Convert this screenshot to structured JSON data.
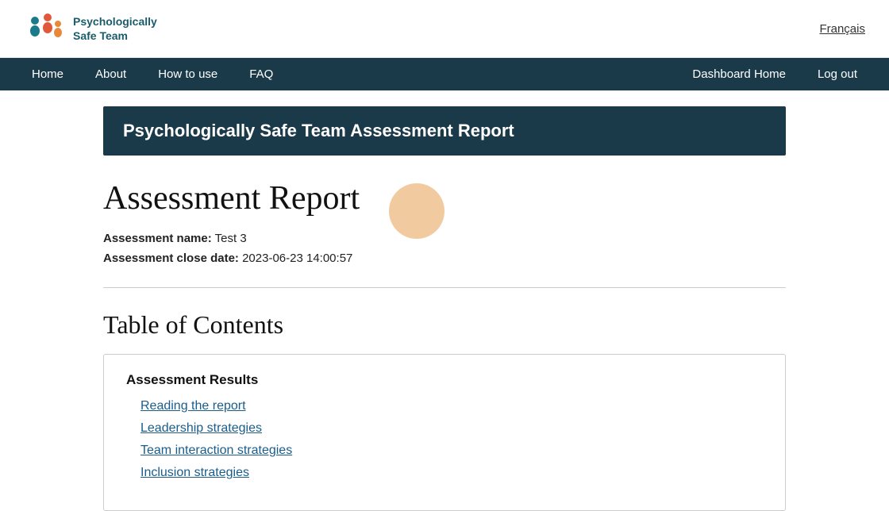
{
  "header": {
    "logo_line1": "Psychologically",
    "logo_line2": "Safe Team",
    "lang_label": "Français"
  },
  "nav": {
    "items": [
      {
        "label": "Home",
        "id": "home"
      },
      {
        "label": "About",
        "id": "about"
      },
      {
        "label": "How to use",
        "id": "how-to-use"
      },
      {
        "label": "FAQ",
        "id": "faq"
      },
      {
        "label": "Dashboard Home",
        "id": "dashboard-home"
      },
      {
        "label": "Log out",
        "id": "logout"
      }
    ]
  },
  "report_banner": {
    "title": "Psychologically Safe Team Assessment Report"
  },
  "assessment": {
    "heading": "Assessment Report",
    "name_label": "Assessment name:",
    "name_value": "Test 3",
    "close_date_label": "Assessment close date:",
    "close_date_value": "2023-06-23 14:00:57"
  },
  "toc": {
    "heading": "Table of Contents",
    "section_title": "Assessment Results",
    "links": [
      {
        "label": "Reading the report",
        "id": "reading-the-report"
      },
      {
        "label": "Leadership strategies",
        "id": "leadership-strategies"
      },
      {
        "label": "Team interaction strategies",
        "id": "team-interaction-strategies"
      },
      {
        "label": "Inclusion strategies",
        "id": "inclusion-strategies"
      }
    ]
  },
  "colors": {
    "nav_bg": "#1a3a4a",
    "banner_bg": "#1a3a4a",
    "link_color": "#1a5c8a"
  }
}
